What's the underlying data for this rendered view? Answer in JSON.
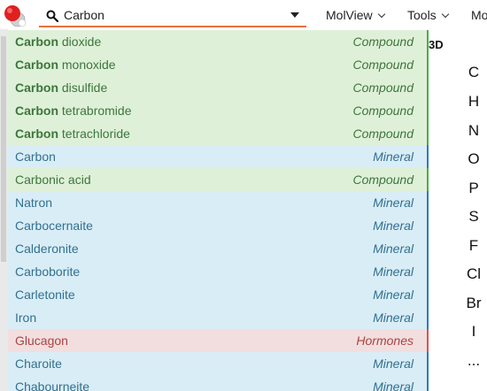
{
  "toolbar": {
    "search": {
      "value": "Carbon",
      "placeholder": ""
    },
    "menus": [
      {
        "label": "MolView"
      },
      {
        "label": "Tools"
      },
      {
        "label": "Mo"
      }
    ]
  },
  "colors": {
    "accent": "#e8703a",
    "compound_bg": "#dff0d8",
    "compound_text": "#3c763d",
    "mineral_bg": "#d9edf7",
    "mineral_text": "#31708f",
    "hormones_bg": "#f2dede",
    "hormones_text": "#a94442"
  },
  "results": [
    {
      "match": "Carbon",
      "rest": " dioxide",
      "type": "Compound",
      "category": "compound"
    },
    {
      "match": "Carbon",
      "rest": " monoxide",
      "type": "Compound",
      "category": "compound"
    },
    {
      "match": "Carbon",
      "rest": " disulfide",
      "type": "Compound",
      "category": "compound"
    },
    {
      "match": "Carbon",
      "rest": " tetrabromide",
      "type": "Compound",
      "category": "compound"
    },
    {
      "match": "Carbon",
      "rest": " tetrachloride",
      "type": "Compound",
      "category": "compound"
    },
    {
      "match": "",
      "rest": "Carbon",
      "type": "Mineral",
      "category": "mineral"
    },
    {
      "match": "",
      "rest": "Carbonic acid",
      "type": "Compound",
      "category": "compound"
    },
    {
      "match": "",
      "rest": "Natron",
      "type": "Mineral",
      "category": "mineral"
    },
    {
      "match": "",
      "rest": "Carbocernaite",
      "type": "Mineral",
      "category": "mineral"
    },
    {
      "match": "",
      "rest": "Calderonite",
      "type": "Mineral",
      "category": "mineral"
    },
    {
      "match": "",
      "rest": "Carboborite",
      "type": "Mineral",
      "category": "mineral"
    },
    {
      "match": "",
      "rest": "Carletonite",
      "type": "Mineral",
      "category": "mineral"
    },
    {
      "match": "",
      "rest": "Iron",
      "type": "Mineral",
      "category": "mineral"
    },
    {
      "match": "",
      "rest": "Glucagon",
      "type": "Hormones",
      "category": "hormones"
    },
    {
      "match": "",
      "rest": "Charoite",
      "type": "Mineral",
      "category": "mineral"
    },
    {
      "match": "",
      "rest": "Chabourneite",
      "type": "Mineral",
      "category": "mineral"
    }
  ],
  "right_panel": {
    "label_3d": "3D",
    "elements": [
      "C",
      "H",
      "N",
      "O",
      "P",
      "S",
      "F",
      "Cl",
      "Br",
      "I",
      "..."
    ]
  },
  "icons": {
    "logo": "molview-logo",
    "search": "search-icon",
    "dropdown": "chevron-down-icon"
  }
}
